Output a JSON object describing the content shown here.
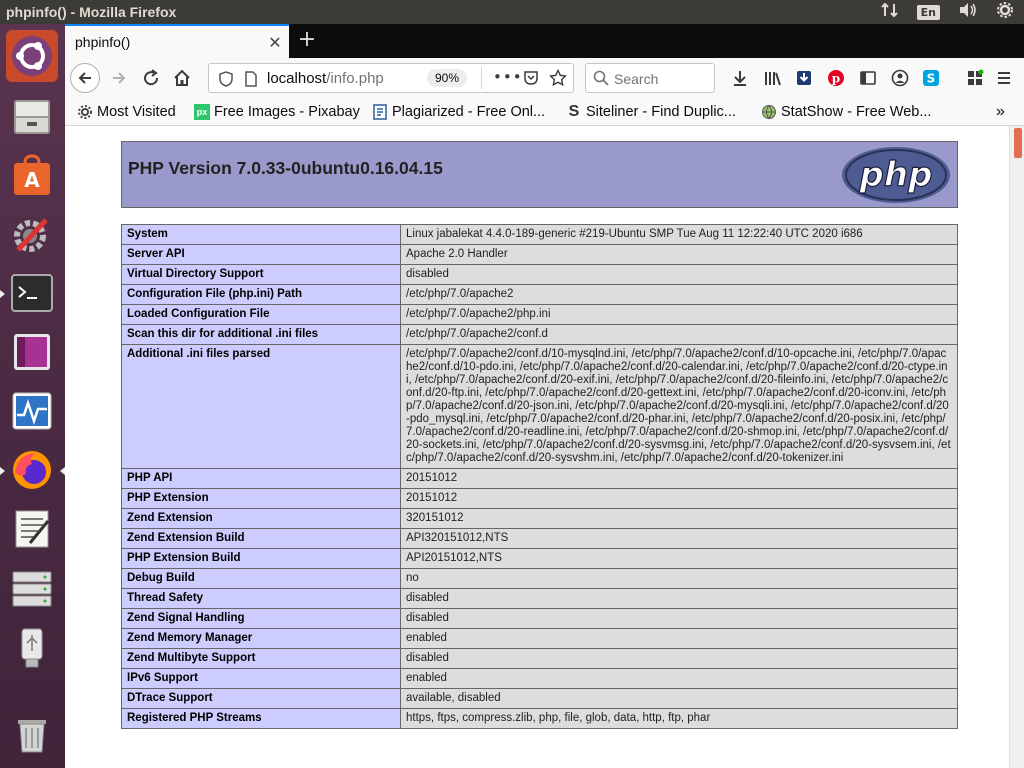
{
  "window": {
    "title": "phpinfo() - Mozilla Firefox"
  },
  "tray": {
    "keyboard": "En"
  },
  "tab": {
    "title": "phpinfo()"
  },
  "navbar": {
    "url_host": "localhost",
    "url_path": "/info.php",
    "zoom": "90%",
    "search_placeholder": "Search"
  },
  "bookmarks": [
    {
      "label": "Most Visited",
      "icon": "gear-icon"
    },
    {
      "label": "Free Images - Pixabay",
      "icon": "px"
    },
    {
      "label": "Plagiarized - Free Onl...",
      "icon": "doc-icon"
    },
    {
      "label": "Siteliner - Find Duplic...",
      "icon": "s-icon"
    },
    {
      "label": "StatShow - Free Web...",
      "icon": "globe-icon"
    }
  ],
  "php": {
    "version": "PHP Version 7.0.33-0ubuntu0.16.04.15",
    "rows": [
      {
        "k": "System",
        "v": "Linux jabalekat 4.4.0-189-generic #219-Ubuntu SMP Tue Aug 11 12:22:40 UTC 2020 i686"
      },
      {
        "k": "Server API",
        "v": "Apache 2.0 Handler"
      },
      {
        "k": "Virtual Directory Support",
        "v": "disabled"
      },
      {
        "k": "Configuration File (php.ini) Path",
        "v": "/etc/php/7.0/apache2"
      },
      {
        "k": "Loaded Configuration File",
        "v": "/etc/php/7.0/apache2/php.ini"
      },
      {
        "k": "Scan this dir for additional .ini files",
        "v": "/etc/php/7.0/apache2/conf.d"
      },
      {
        "k": "Additional .ini files parsed",
        "v": "/etc/php/7.0/apache2/conf.d/10-mysqlnd.ini, /etc/php/7.0/apache2/conf.d/10-opcache.ini, /etc/php/7.0/apache2/conf.d/10-pdo.ini, /etc/php/7.0/apache2/conf.d/20-calendar.ini, /etc/php/7.0/apache2/conf.d/20-ctype.ini, /etc/php/7.0/apache2/conf.d/20-exif.ini, /etc/php/7.0/apache2/conf.d/20-fileinfo.ini, /etc/php/7.0/apache2/conf.d/20-ftp.ini, /etc/php/7.0/apache2/conf.d/20-gettext.ini, /etc/php/7.0/apache2/conf.d/20-iconv.ini, /etc/php/7.0/apache2/conf.d/20-json.ini, /etc/php/7.0/apache2/conf.d/20-mysqli.ini, /etc/php/7.0/apache2/conf.d/20-pdo_mysql.ini, /etc/php/7.0/apache2/conf.d/20-phar.ini, /etc/php/7.0/apache2/conf.d/20-posix.ini, /etc/php/7.0/apache2/conf.d/20-readline.ini, /etc/php/7.0/apache2/conf.d/20-shmop.ini, /etc/php/7.0/apache2/conf.d/20-sockets.ini, /etc/php/7.0/apache2/conf.d/20-sysvmsg.ini, /etc/php/7.0/apache2/conf.d/20-sysvsem.ini, /etc/php/7.0/apache2/conf.d/20-sysvshm.ini, /etc/php/7.0/apache2/conf.d/20-tokenizer.ini"
      },
      {
        "k": "PHP API",
        "v": "20151012"
      },
      {
        "k": "PHP Extension",
        "v": "20151012"
      },
      {
        "k": "Zend Extension",
        "v": "320151012"
      },
      {
        "k": "Zend Extension Build",
        "v": "API320151012,NTS"
      },
      {
        "k": "PHP Extension Build",
        "v": "API20151012,NTS"
      },
      {
        "k": "Debug Build",
        "v": "no"
      },
      {
        "k": "Thread Safety",
        "v": "disabled"
      },
      {
        "k": "Zend Signal Handling",
        "v": "disabled"
      },
      {
        "k": "Zend Memory Manager",
        "v": "enabled"
      },
      {
        "k": "Zend Multibyte Support",
        "v": "disabled"
      },
      {
        "k": "IPv6 Support",
        "v": "enabled"
      },
      {
        "k": "DTrace Support",
        "v": "available, disabled"
      },
      {
        "k": "Registered PHP Streams",
        "v": "https, ftps, compress.zlib, php, file, glob, data, http, ftp, phar"
      }
    ]
  }
}
